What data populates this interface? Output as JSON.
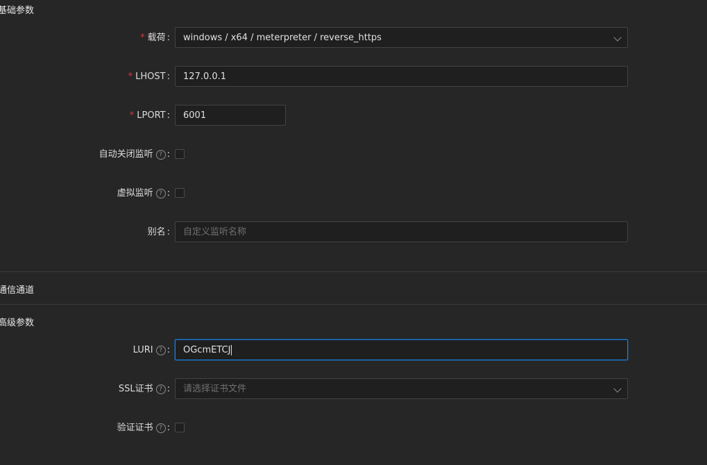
{
  "sections": {
    "basic": "基础参数",
    "comm": "通信通道",
    "advanced": "高级参数"
  },
  "fields": {
    "payload": {
      "label": "载荷",
      "value": "windows / x64 / meterpreter / reverse_https"
    },
    "lhost": {
      "label": "LHOST",
      "value": "127.0.0.1"
    },
    "lport": {
      "label": "LPORT",
      "value": "6001"
    },
    "auto_close": {
      "label": "自动关闭监听"
    },
    "virtual": {
      "label": "虚拟监听"
    },
    "alias": {
      "label": "别名",
      "placeholder": "自定义监听名称"
    },
    "luri": {
      "label": "LURI",
      "value": "OGcmETCJ"
    },
    "ssl_cert": {
      "label": "SSL证书",
      "placeholder": "请选择证书文件"
    },
    "verify_cert": {
      "label": "验证证书"
    }
  },
  "symbols": {
    "required": "*",
    "colon": ":",
    "help": "?"
  }
}
